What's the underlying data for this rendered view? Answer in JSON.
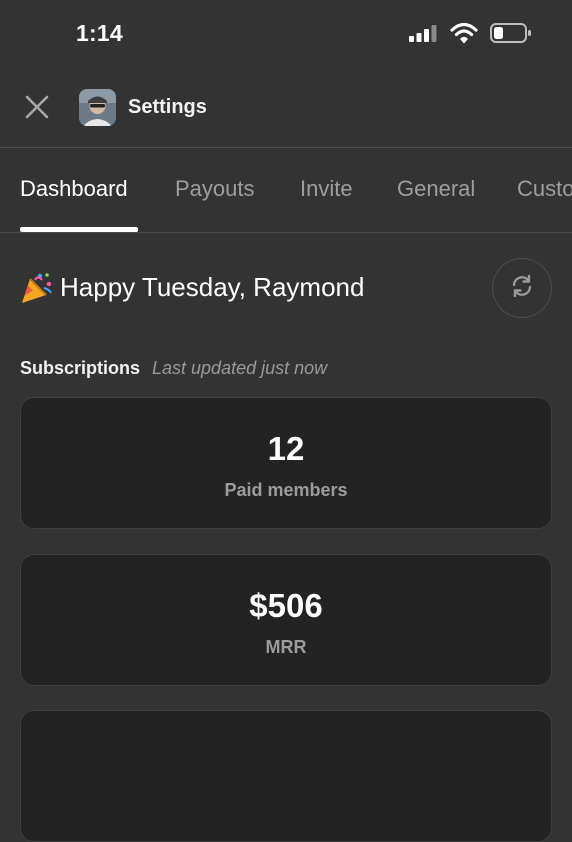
{
  "status_bar": {
    "time": "1:14"
  },
  "header": {
    "title": "Settings"
  },
  "tabs": [
    {
      "label": "Dashboard",
      "active": true
    },
    {
      "label": "Payouts",
      "active": false
    },
    {
      "label": "Invite",
      "active": false
    },
    {
      "label": "General",
      "active": false
    },
    {
      "label": "Custo",
      "active": false
    }
  ],
  "greeting": {
    "text": "Happy Tuesday, Raymond"
  },
  "subscriptions": {
    "title": "Subscriptions",
    "subtitle": "Last updated just now",
    "cards": [
      {
        "value": "12",
        "label": "Paid members"
      },
      {
        "value": "$506",
        "label": "MRR"
      }
    ]
  },
  "colors": {
    "background": "#333333",
    "card": "#232323",
    "muted": "#9e9e9e"
  },
  "icons": [
    "signal-icon",
    "wifi-icon",
    "battery-icon",
    "close-icon",
    "avatar",
    "party-popper-icon",
    "refresh-icon"
  ]
}
